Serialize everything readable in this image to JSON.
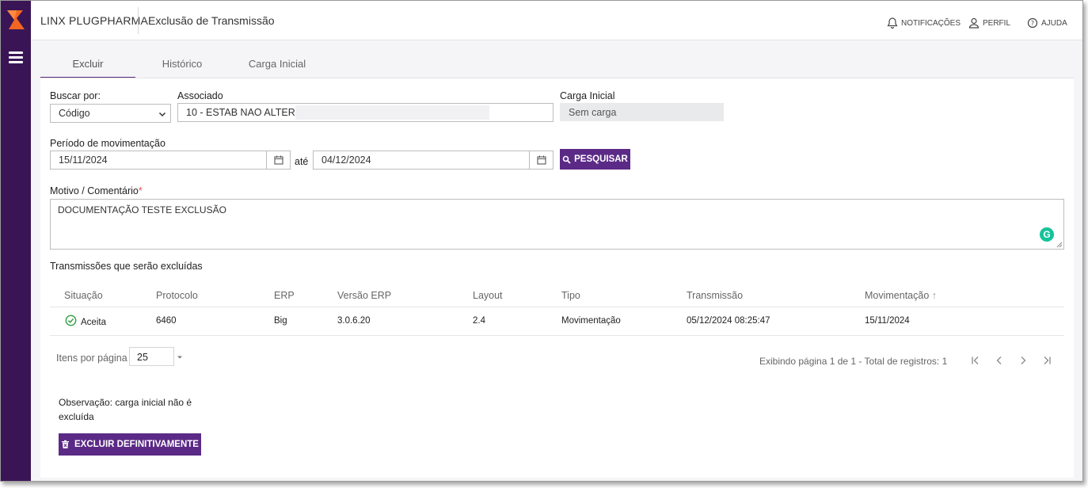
{
  "app": {
    "brand": "LINX PLUGPHARMA",
    "page_title": "Exclusão de Transmissão"
  },
  "header": {
    "notifications": "NOTIFICAÇÕES",
    "profile": "PERFIL",
    "help": "AJUDA"
  },
  "tabs": [
    {
      "label": "Excluir",
      "active": true
    },
    {
      "label": "Histórico",
      "active": false
    },
    {
      "label": "Carga Inicial",
      "active": false
    }
  ],
  "form": {
    "search_by_label": "Buscar por:",
    "search_by_value": "Código",
    "associate_label": "Associado",
    "associate_value": "10 - ESTAB NAO ALTERAR",
    "initial_load_label": "Carga Inicial",
    "initial_load_value": "Sem carga",
    "period_label": "Período de movimentação",
    "date_from": "15/11/2024",
    "until": "até",
    "date_to": "04/12/2024",
    "search_button": "PESQUISAR",
    "reason_label": "Motivo / Comentário",
    "reason_required": "*",
    "reason_value": "DOCUMENTAÇÃO TESTE EXCLUSÃO"
  },
  "table": {
    "caption": "Transmissões que serão excluídas",
    "columns": [
      "Situação",
      "Protocolo",
      "ERP",
      "Versão ERP",
      "Layout",
      "Tipo",
      "Transmissão",
      "Movimentação"
    ],
    "sort_indicator": "↑",
    "rows": [
      {
        "status": "Aceita",
        "protocol": "6460",
        "erp": "Big",
        "erp_version": "3.0.6.20",
        "layout": "2.4",
        "type": "Movimentação",
        "transmission": "05/12/2024 08:25:47",
        "movement": "15/11/2024"
      }
    ]
  },
  "pagination": {
    "per_page_label": "Itens por página",
    "per_page_value": "25",
    "summary": "Exibindo página 1 de 1 - Total de registros: 1"
  },
  "note": {
    "line1": "Observação: carga inicial não é",
    "line2": "excluída"
  },
  "delete_button": "EXCLUIR DEFINITIVAMENTE",
  "colors": {
    "sidebar": "#3a1556",
    "accent": "#5b2a86",
    "success": "#2e9e3e",
    "logo": "#f26522"
  }
}
